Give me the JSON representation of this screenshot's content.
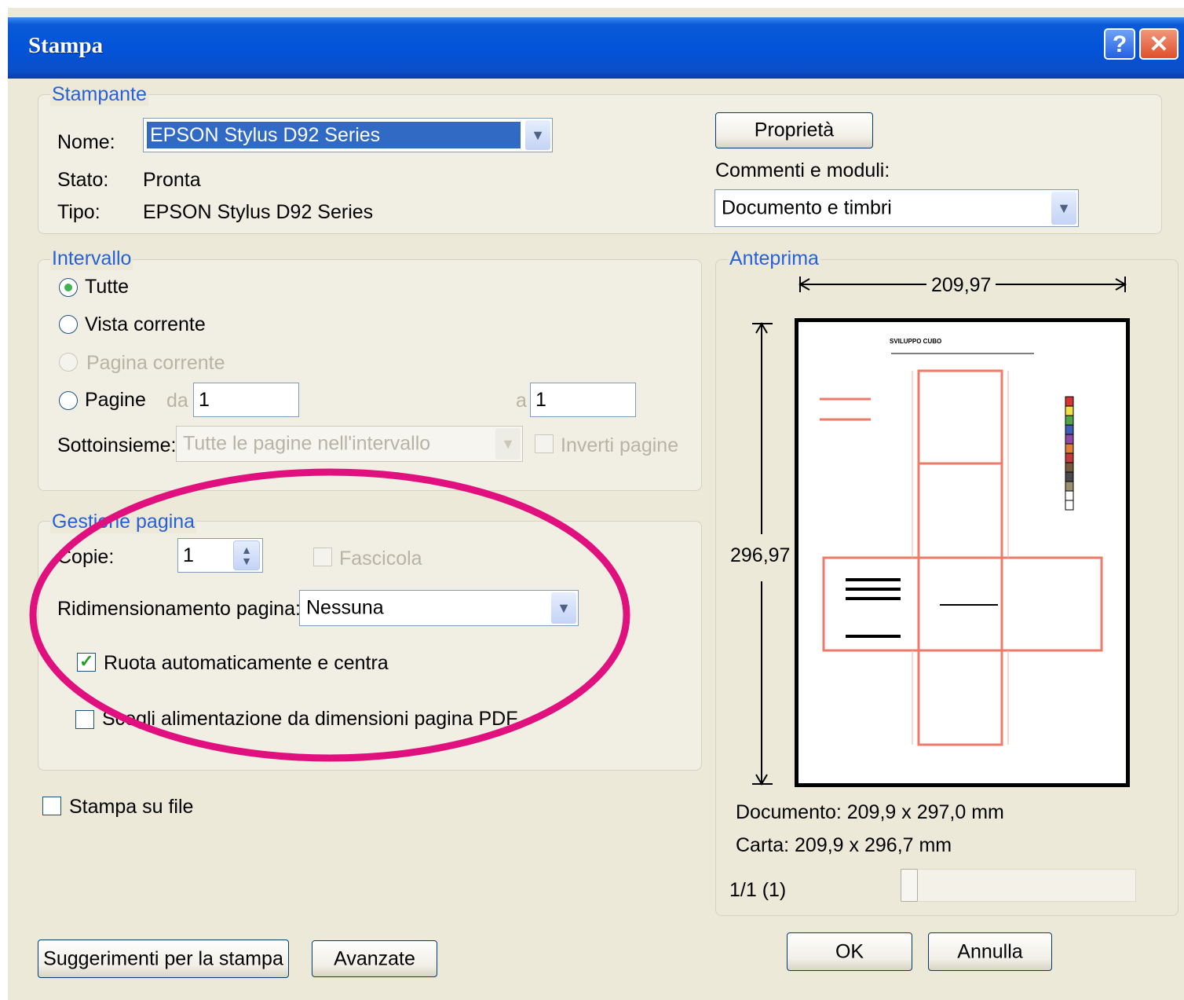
{
  "window": {
    "title": "Stampa",
    "help_label": "?",
    "close_label": "✕"
  },
  "printer": {
    "legend": "Stampante",
    "name_label": "Nome:",
    "name_value": "EPSON Stylus D92 Series",
    "status_label": "Stato:",
    "status_value": "Pronta",
    "type_label": "Tipo:",
    "type_value": "EPSON Stylus D92 Series",
    "properties_button": "Proprietà",
    "comments_label": "Commenti e moduli:",
    "comments_value": "Documento e  timbri"
  },
  "range": {
    "legend": "Intervallo",
    "all_label": "Tutte",
    "current_view_label": "Vista corrente",
    "current_page_label": "Pagina corrente",
    "pages_label": "Pagine",
    "from_label": "da",
    "from_value": "1",
    "to_label": "a",
    "to_value": "1",
    "subset_label": "Sottoinsieme:",
    "subset_value": "Tutte le pagine nell'intervallo",
    "reverse_label": "Inverti pagine"
  },
  "page_handling": {
    "legend": "Gestione pagina",
    "copies_label": "Copie:",
    "copies_value": "1",
    "collate_label": "Fascicola",
    "scaling_label": "Ridimensionamento pagina:",
    "scaling_value": "Nessuna",
    "auto_rotate_label": "Ruota automaticamente e centra",
    "pdf_paper_label": "Scegli alimentazione da dimensioni pagina PDF"
  },
  "print_to_file_label": "Stampa su file",
  "preview": {
    "legend": "Anteprima",
    "width_value": "209,97",
    "height_value": "296,97",
    "page_heading": "SVILUPPO CUBO",
    "document_size": "Documento: 209,9 x 297,0 mm",
    "paper_size": "Carta: 209,9 x 296,7 mm",
    "page_counter": "1/1 (1)"
  },
  "buttons": {
    "tips": "Suggerimenti per la stampa",
    "advanced": "Avanzate",
    "ok": "OK",
    "cancel": "Annulla"
  },
  "colors": {
    "titlebar": "#0353d9",
    "accent_legend": "#2860d8",
    "annotation_ellipse": "#e0107f",
    "die_line": "#f07a68"
  }
}
